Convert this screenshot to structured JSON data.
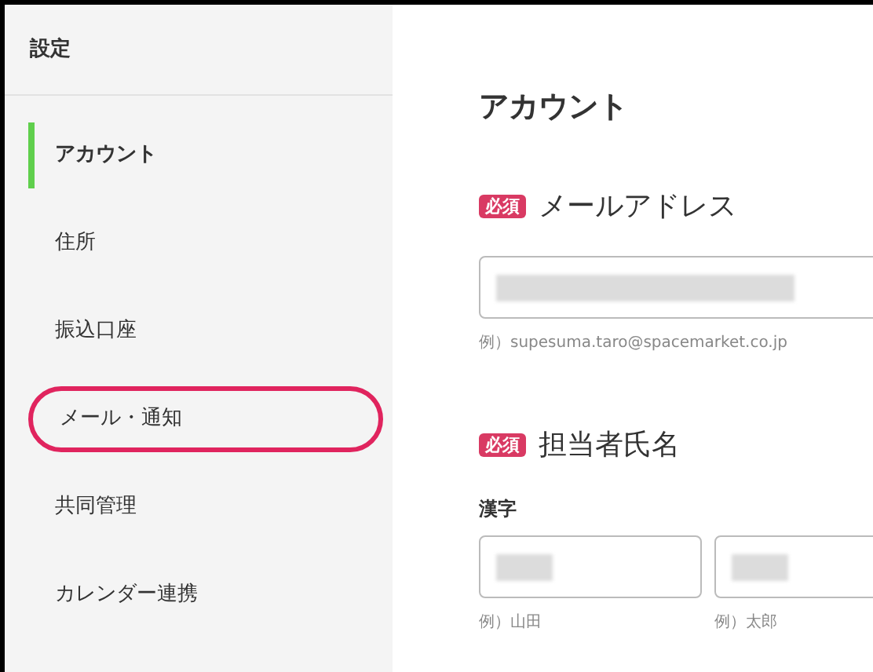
{
  "sidebar": {
    "title": "設定",
    "items": [
      {
        "label": "アカウント",
        "selected": true,
        "highlighted": false
      },
      {
        "label": "住所",
        "selected": false,
        "highlighted": false
      },
      {
        "label": "振込口座",
        "selected": false,
        "highlighted": false
      },
      {
        "label": "メール・通知",
        "selected": false,
        "highlighted": true
      },
      {
        "label": "共同管理",
        "selected": false,
        "highlighted": false
      },
      {
        "label": "カレンダー連携",
        "selected": false,
        "highlighted": false
      }
    ]
  },
  "main": {
    "heading": "アカウント",
    "sections": [
      {
        "badge": "必須",
        "title": "メールアドレス",
        "fields": [
          {
            "hint": "例）supesuma.taro@spacemarket.co.jp"
          }
        ]
      },
      {
        "badge": "必須",
        "title": "担当者氏名",
        "sublabel": "漢字",
        "fields": [
          {
            "hint": "例）山田"
          },
          {
            "hint": "例）太郎"
          }
        ]
      }
    ]
  }
}
